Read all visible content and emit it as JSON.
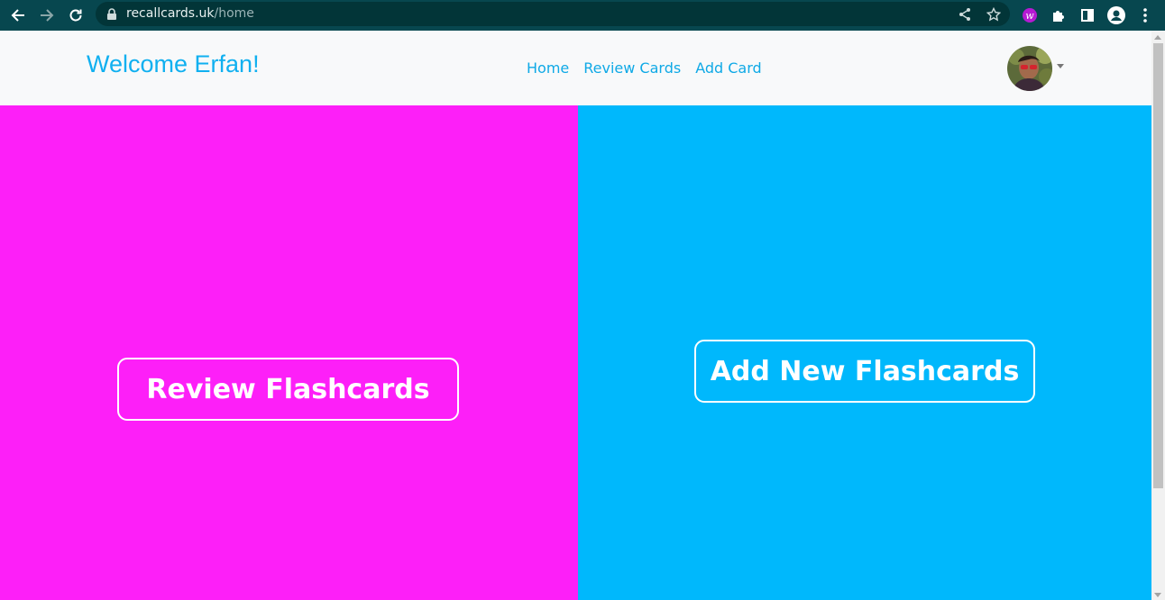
{
  "browser": {
    "url_host": "recallcards.uk",
    "url_path": "/home",
    "extension_badge": "w"
  },
  "navbar": {
    "brand": "Welcome Erfan!",
    "links": [
      "Home",
      "Review Cards",
      "Add Card"
    ]
  },
  "main": {
    "review_button": "Review Flashcards",
    "add_button": "Add New Flashcards"
  },
  "colors": {
    "chrome": "#07474f",
    "brand": "#10b0f0",
    "review_panel": "#fd1ff8",
    "add_panel": "#00b8fc"
  },
  "icons": [
    "back-arrow-icon",
    "forward-arrow-icon",
    "reload-icon",
    "lock-icon",
    "share-icon",
    "star-icon",
    "extension-w-icon",
    "puzzle-icon",
    "side-panel-icon",
    "profile-icon",
    "more-vert-icon",
    "avatar",
    "caret-down-icon"
  ]
}
